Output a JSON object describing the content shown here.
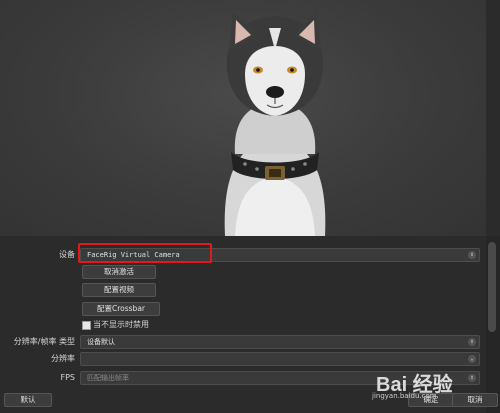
{
  "preview": {
    "alt": "husky dog avatar"
  },
  "device": {
    "label": "设备",
    "value": "FaceRig Virtual Camera"
  },
  "buttons": {
    "deactivate": "取消激活",
    "configure_video": "配置视频",
    "configure_crossbar": "配置Crossbar",
    "defaults": "默认",
    "ok": "确定",
    "cancel": "取消"
  },
  "checkbox": {
    "label": "当不显示时禁用",
    "checked": false
  },
  "resolution_type": {
    "label": "分辨率/帧率 类型",
    "value": "设备默认"
  },
  "resolution": {
    "label": "分辨率",
    "value": ""
  },
  "fps": {
    "label": "FPS",
    "value": "匹配输出帧率"
  },
  "watermark": {
    "logo": "Bai 经验",
    "url": "jingyan.baidu.com"
  },
  "colors": {
    "highlight": "#e0191b",
    "background": "#2b2b2b"
  }
}
